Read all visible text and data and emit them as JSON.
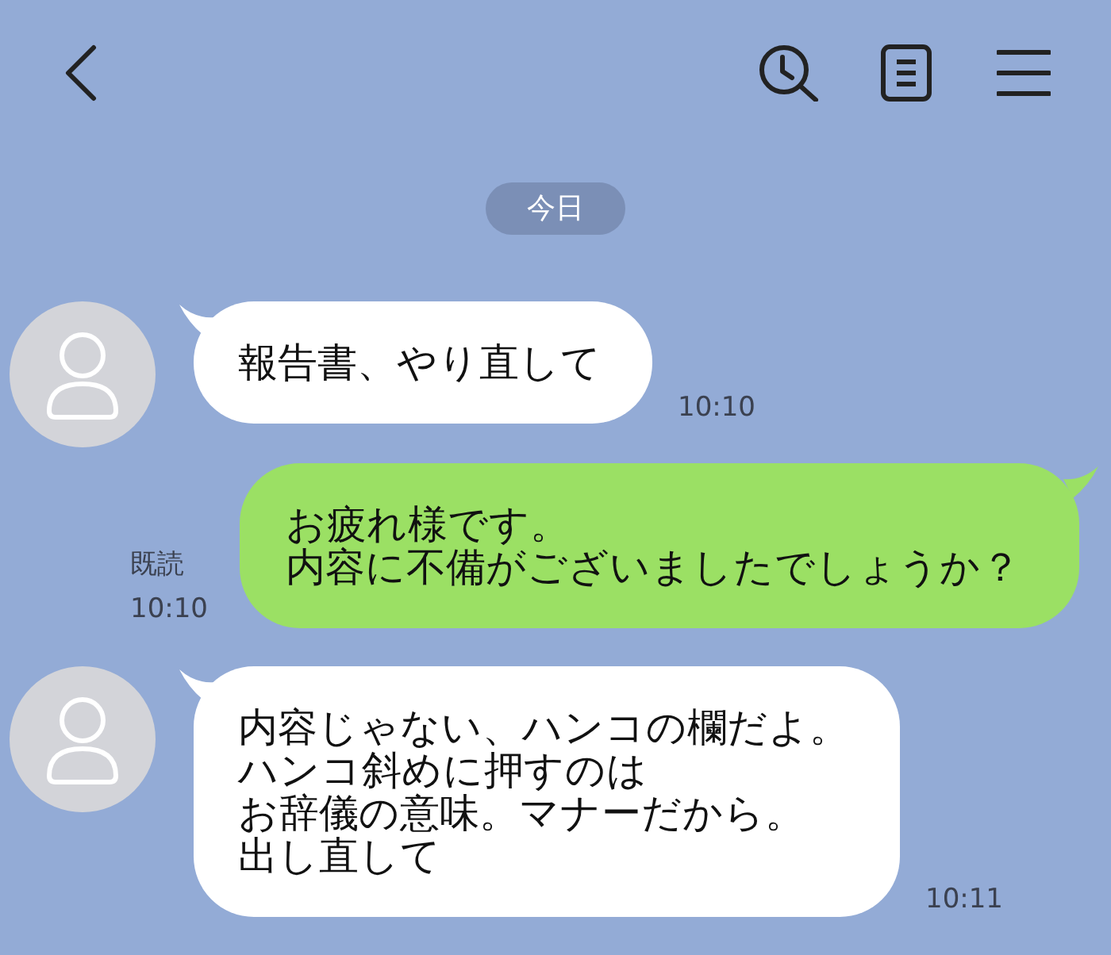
{
  "date_separator": {
    "label": "今日"
  },
  "messages": [
    {
      "kind": "received",
      "lines": [
        "報告書、やり直して"
      ],
      "time": "10:10"
    },
    {
      "kind": "sent",
      "lines": [
        "お疲れ様です。",
        "内容に不備がございましたでしょうか？"
      ],
      "read_label": "既読",
      "time": "10:10"
    },
    {
      "kind": "received",
      "lines": [
        "内容じゃない、ハンコの欄だよ。",
        "ハンコ斜めに押すのは",
        "お辞儀の意味。マナーだから。",
        "出し直して"
      ],
      "time": "10:11"
    }
  ]
}
